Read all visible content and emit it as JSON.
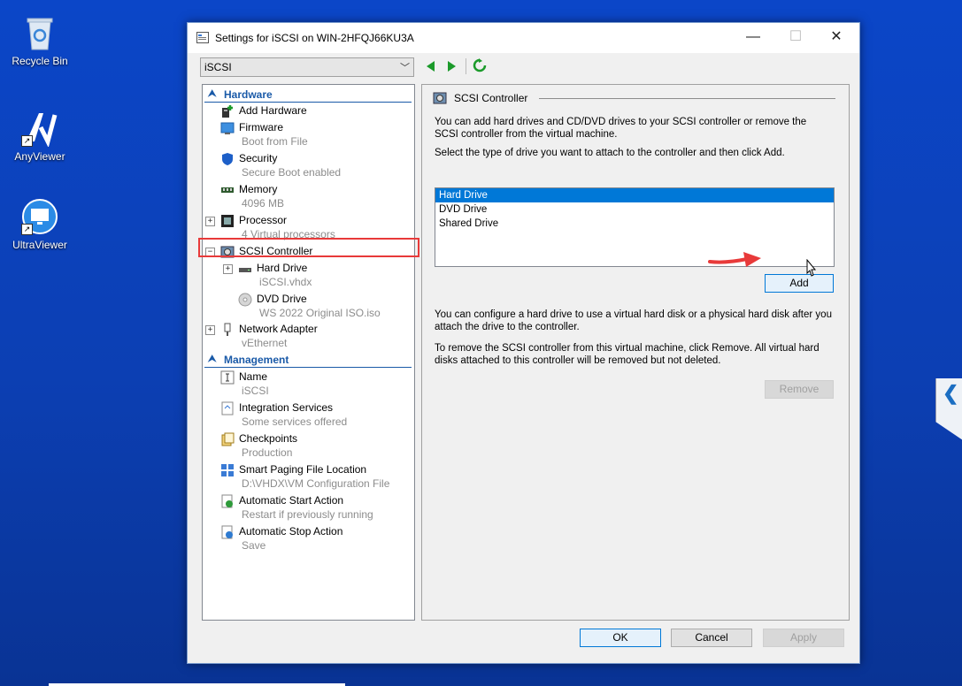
{
  "desktop": {
    "icons": [
      {
        "label": "Recycle Bin",
        "icon": "recycle-bin-icon"
      },
      {
        "label": "AnyViewer",
        "icon": "anyviewer-icon"
      },
      {
        "label": "UltraViewer",
        "icon": "ultraviewer-icon"
      }
    ]
  },
  "window": {
    "title": "Settings for iSCSI on WIN-2HFQJ66KU3A",
    "controls": {
      "minimize": "—",
      "maximize": "☐",
      "close": "✕"
    }
  },
  "toolbar": {
    "vm_selected": "iSCSI"
  },
  "tree": {
    "hardware_header": "Hardware",
    "management_header": "Management",
    "items": {
      "add_hardware": {
        "name": "Add Hardware"
      },
      "firmware": {
        "name": "Firmware",
        "sub": "Boot from File"
      },
      "security": {
        "name": "Security",
        "sub": "Secure Boot enabled"
      },
      "memory": {
        "name": "Memory",
        "sub": "4096 MB"
      },
      "processor": {
        "name": "Processor",
        "sub": "4 Virtual processors"
      },
      "scsi": {
        "name": "SCSI Controller"
      },
      "hard_drive": {
        "name": "Hard Drive",
        "sub": "iSCSI.vhdx"
      },
      "dvd_drive": {
        "name": "DVD Drive",
        "sub": "WS 2022 Original ISO.iso"
      },
      "network": {
        "name": "Network Adapter",
        "sub": "vEthernet"
      },
      "name": {
        "name": "Name",
        "sub": "iSCSI"
      },
      "integration": {
        "name": "Integration Services",
        "sub": "Some services offered"
      },
      "checkpoints": {
        "name": "Checkpoints",
        "sub": "Production"
      },
      "smart_paging": {
        "name": "Smart Paging File Location",
        "sub": "D:\\VHDX\\VM Configuration File"
      },
      "auto_start": {
        "name": "Automatic Start Action",
        "sub": "Restart if previously running"
      },
      "auto_stop": {
        "name": "Automatic Stop Action",
        "sub": "Save"
      }
    }
  },
  "panel": {
    "header": "SCSI Controller",
    "intro": "You can add hard drives and CD/DVD drives to your SCSI controller or remove the SCSI controller from the virtual machine.",
    "select_prompt": "Select the type of drive you want to attach to the controller and then click Add.",
    "drive_types": [
      "Hard Drive",
      "DVD Drive",
      "Shared Drive"
    ],
    "selected_drive_type": "Hard Drive",
    "add_label": "Add",
    "configure_text": "You can configure a hard drive to use a virtual hard disk or a physical hard disk after you attach the drive to the controller.",
    "remove_text": "To remove the SCSI controller from this virtual machine, click Remove. All virtual hard disks attached to this controller will be removed but not deleted.",
    "remove_label": "Remove"
  },
  "footer": {
    "ok_label": "OK",
    "cancel_label": "Cancel",
    "apply_label": "Apply"
  },
  "colors": {
    "accent": "#0078d7",
    "section_header": "#1a5aa8",
    "highlight_box": "#e83a3a",
    "desktop_bg": "#0c3fb3"
  }
}
